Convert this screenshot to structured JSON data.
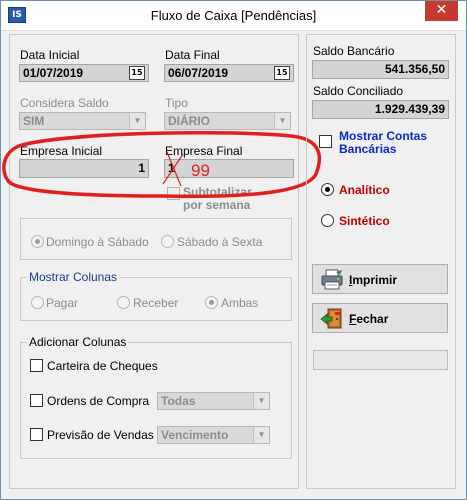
{
  "window": {
    "title": "Fluxo de Caixa [Pendências]",
    "app_icon_text": "IS",
    "close_symbol": "✕"
  },
  "dates": {
    "inicial_label": "Data Inicial",
    "inicial_value": "01/07/2019",
    "final_label": "Data Final",
    "final_value": "06/07/2019",
    "calendar_icon_text": "15"
  },
  "saldo": {
    "considera_label": "Considera Saldo",
    "considera_value": "SIM",
    "tipo_label": "Tipo",
    "tipo_value": "DIÁRIO"
  },
  "empresa": {
    "inicial_label": "Empresa Inicial",
    "inicial_value": "1",
    "final_label": "Empresa Final",
    "final_value": "1",
    "annotation_text": "99",
    "annotation_color": "#e21f1f"
  },
  "subtotalizar": {
    "label_line1": "Subtotalizar",
    "label_line2": "por semana"
  },
  "semana": {
    "domingo": "Domingo à Sábado",
    "sabado": "Sábado à Sexta"
  },
  "mostrar_colunas": {
    "legend": "Mostrar Colunas",
    "pagar": "Pagar",
    "receber": "Receber",
    "ambas": "Ambas"
  },
  "adicionar_colunas": {
    "legend": "Adicionar Colunas",
    "cheques": "Carteira de Cheques",
    "ordens": "Ordens de Compra",
    "ordens_select": "Todas",
    "previsao": "Previsão de Vendas",
    "previsao_select": "Vencimento"
  },
  "right_panel": {
    "saldo_bancario_label": "Saldo Bancário",
    "saldo_bancario_value": "541.356,50",
    "saldo_conciliado_label": "Saldo Conciliado",
    "saldo_conciliado_value": "1.929.439,39",
    "mostrar_contas_line1": "Mostrar Contas",
    "mostrar_contas_line2": "Bancárias",
    "analitico": "Analítico",
    "sintetico": "Sintético",
    "imprimir": "Imprimir",
    "fechar": "Fechar"
  },
  "colors": {
    "accent_red": "#c00000",
    "accent_blue": "#0a2ac8",
    "close_red": "#c7392f"
  },
  "icons": [
    "app-icon",
    "calendar-icon",
    "dropdown-arrow-icon",
    "printer-icon",
    "exit-door-icon",
    "close-icon"
  ]
}
